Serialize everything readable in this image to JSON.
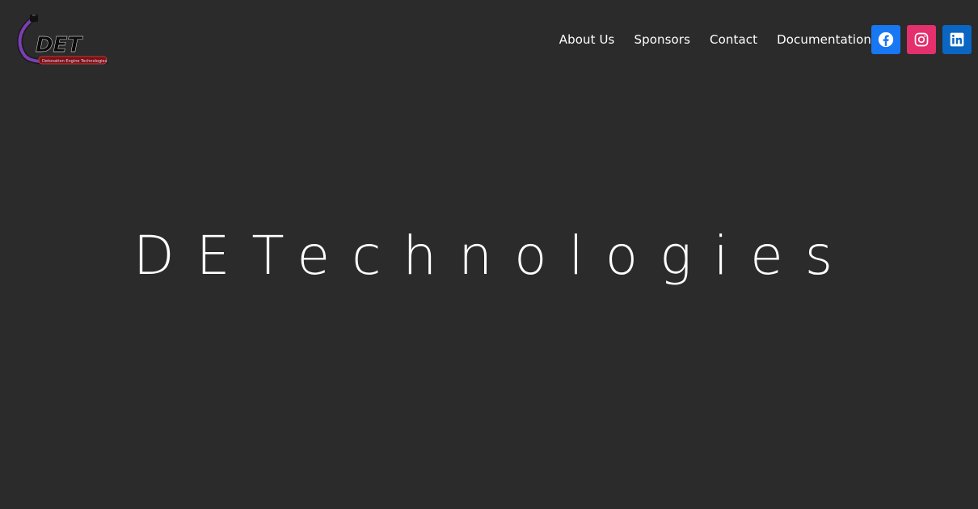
{
  "header": {
    "logo": {
      "text": "DET",
      "tagline": "Detonation Engine Technologies"
    },
    "nav": [
      {
        "label": "About Us"
      },
      {
        "label": "Sponsors"
      },
      {
        "label": "Contact"
      },
      {
        "label": "Documentation"
      }
    ],
    "socials": [
      {
        "icon": "facebook-icon",
        "color": "#1877f2"
      },
      {
        "icon": "instagram-icon",
        "color": "#e4306c"
      },
      {
        "icon": "linkedin-icon",
        "color": "#0a66c2"
      }
    ]
  },
  "hero": {
    "title": "DETechnologies"
  },
  "colors": {
    "background": "#2b2b2b",
    "text": "#ffffff"
  }
}
